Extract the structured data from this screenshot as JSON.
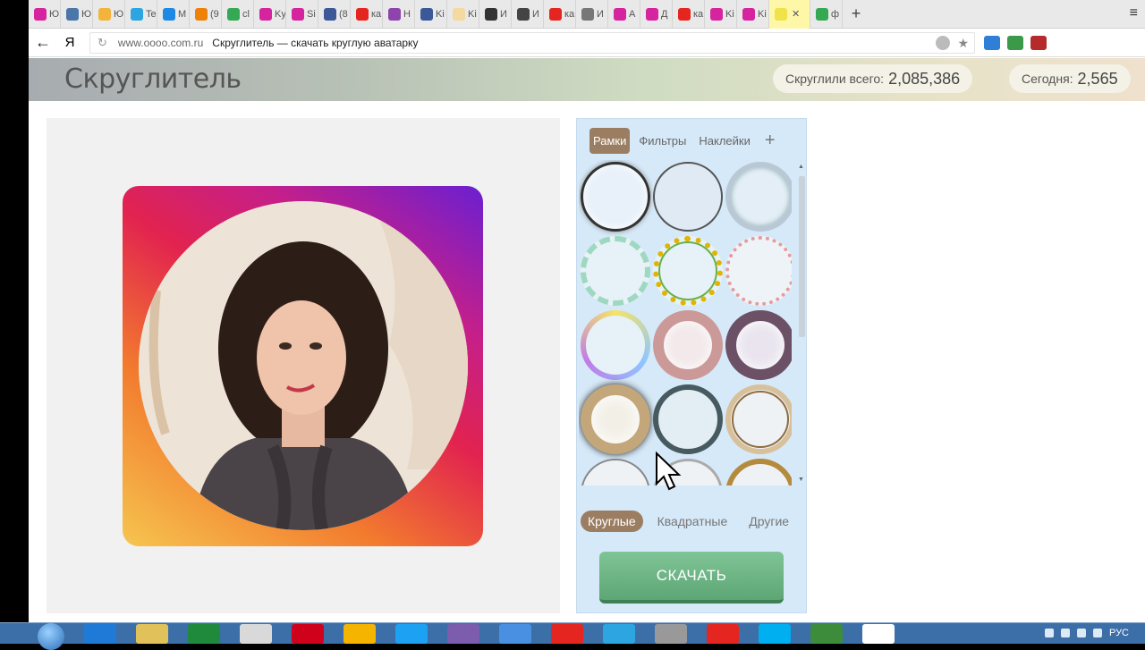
{
  "browser": {
    "tabs": [
      {
        "label": "Ю",
        "color": "#d6249f"
      },
      {
        "label": "Ю",
        "color": "#4a76a8"
      },
      {
        "label": "Ю",
        "color": "#f2b53b"
      },
      {
        "label": "Te",
        "color": "#2ca5e0"
      },
      {
        "label": "M",
        "color": "#1e88e5"
      },
      {
        "label": "(9",
        "color": "#ee8208"
      },
      {
        "label": "cl",
        "color": "#34a853"
      },
      {
        "label": "Ky",
        "color": "#d6249f"
      },
      {
        "label": "Si",
        "color": "#d6249f"
      },
      {
        "label": "(8",
        "color": "#3b5998"
      },
      {
        "label": "ка",
        "color": "#e52620"
      },
      {
        "label": "Н",
        "color": "#8e44ad"
      },
      {
        "label": "Ki",
        "color": "#3b5998"
      },
      {
        "label": "Ki",
        "color": "#f4d9a0"
      },
      {
        "label": "И",
        "color": "#333333"
      },
      {
        "label": "И",
        "color": "#444444"
      },
      {
        "label": "ка",
        "color": "#e52620"
      },
      {
        "label": "И",
        "color": "#777777"
      },
      {
        "label": "А",
        "color": "#d6249f"
      },
      {
        "label": "Д",
        "color": "#d6249f"
      },
      {
        "label": "ка",
        "color": "#e52620"
      },
      {
        "label": "Ki",
        "color": "#d6249f"
      },
      {
        "label": "Ki",
        "color": "#d6249f"
      }
    ],
    "active_tab": {
      "label": "",
      "close": "✕"
    },
    "last_tab": {
      "label": "ф",
      "color": "#34a853"
    },
    "new_tab": "+",
    "menu_icon": "≡",
    "back": "←",
    "yandex_logo": "Я",
    "reload": "↻",
    "domain": "www.oooo.com.ru",
    "page_title": "Скруглитель — скачать круглую аватарку",
    "bookmark": "★"
  },
  "site": {
    "logo": "Скруглитель",
    "stats": {
      "total_label": "Скруглили всего:",
      "total_value": "2,085,386",
      "today_label": "Сегодня:",
      "today_value": "2,565"
    }
  },
  "panel": {
    "tabs": [
      {
        "label": "Рамки",
        "active": true
      },
      {
        "label": "Фильтры",
        "active": false
      },
      {
        "label": "Наклейки",
        "active": false
      }
    ],
    "add": "+",
    "shapes": [
      {
        "label": "Круглые",
        "active": true
      },
      {
        "label": "Квадратные",
        "active": false
      },
      {
        "label": "Другие",
        "active": false
      }
    ],
    "download": "СКАЧАТЬ",
    "scroll_up": "▲",
    "scroll_down": "▼"
  },
  "taskbar": {
    "lang": "РУС",
    "apps": [
      "#1e7ad6",
      "#e0c15a",
      "#1f8a3c",
      "#d9d9d9",
      "#d0021b",
      "#f4b400",
      "#1da1f2",
      "#7b5cad",
      "#4a90e2",
      "#e52620",
      "#2ca5e0",
      "#999999",
      "#e52620",
      "#00aff0",
      "#3c8c3c",
      "#ffffff"
    ]
  }
}
